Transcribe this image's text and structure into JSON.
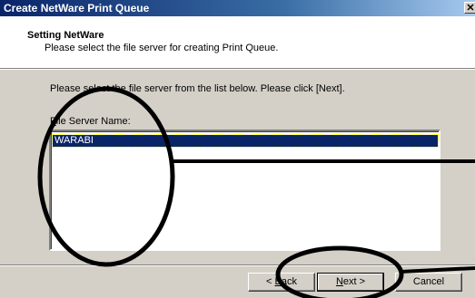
{
  "window": {
    "title": "Create NetWare Print Queue",
    "close_glyph": "✕"
  },
  "header": {
    "title": "Setting NetWare",
    "subtitle": "Please select the file server for creating Print Queue."
  },
  "main": {
    "instruction": "Please select the file server from the list below. Please click [Next].",
    "file_server_label_prefix": "",
    "file_server_label_accel": "F",
    "file_server_label_rest": "ile Server Name:",
    "list_items": [
      "WARABI"
    ]
  },
  "footer": {
    "back_prefix": "< ",
    "back_accel": "B",
    "back_rest": "ack",
    "next_accel": "N",
    "next_rest": "ext >",
    "cancel_label": "Cancel"
  },
  "colors": {
    "titlebar_start": "#0a246a",
    "selection": "#0a246a",
    "dialog_face": "#d4d0c8",
    "annotation": "#000000"
  },
  "icons": {
    "close": "close-icon"
  }
}
